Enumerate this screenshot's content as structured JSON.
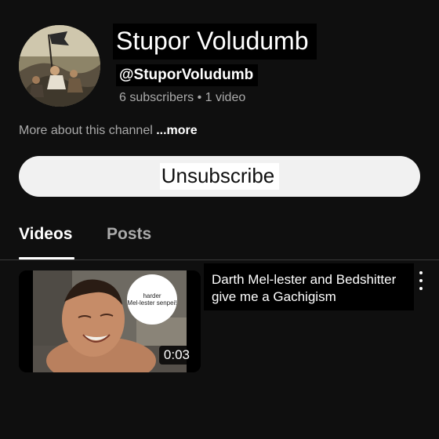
{
  "channel": {
    "name": "Stupor Voludumb",
    "handle": "@StuporVoludumb",
    "stats": "6 subscribers • 1 video",
    "about_text": "More about this channel ",
    "about_more": "...more",
    "subscribe_button_label": "Unsubscribe"
  },
  "tabs": [
    {
      "label": "Videos",
      "active": true
    },
    {
      "label": "Posts",
      "active": false
    }
  ],
  "videos": [
    {
      "title": "Darth Mel-lester and Bedshitter give me a Gachigism",
      "duration": "0:03",
      "thumbnail_bubble": [
        "harder",
        "Mel-lester senpei!"
      ]
    }
  ],
  "icons": {
    "more_menu": "kebab-vertical-icon"
  }
}
